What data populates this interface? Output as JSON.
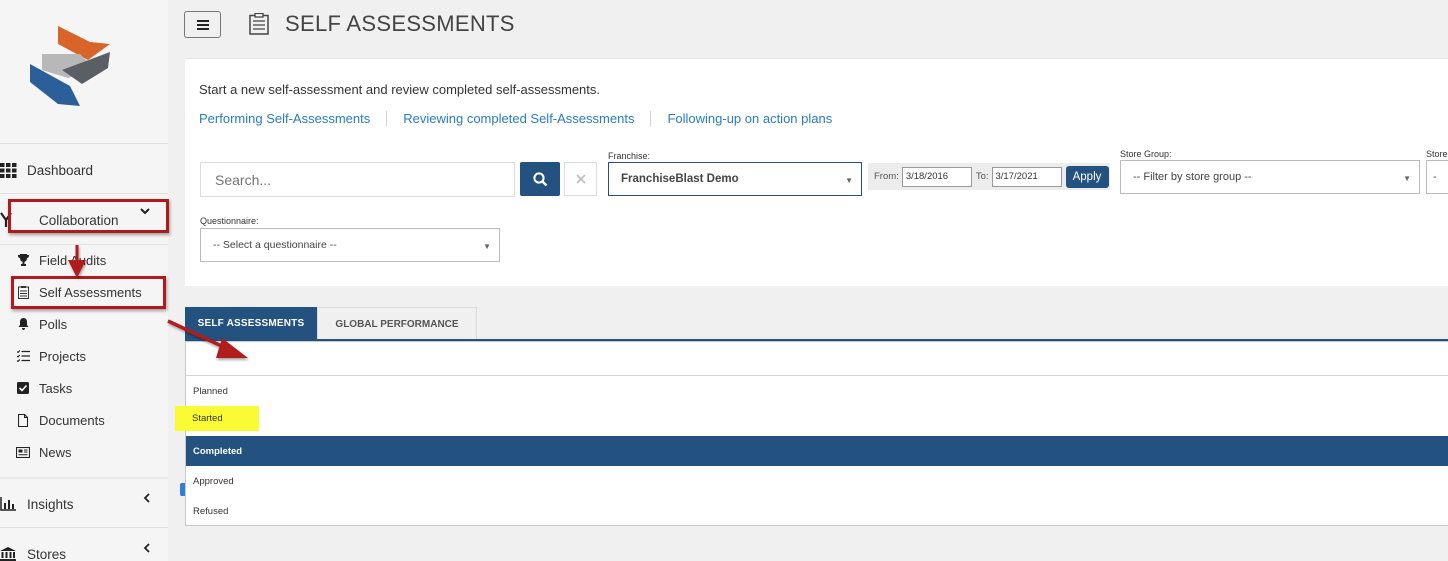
{
  "header": {
    "title": "SELF ASSESSMENTS"
  },
  "sidebar": {
    "main_items": [
      {
        "label": "Dashboard"
      },
      {
        "label": "Collaboration"
      },
      {
        "label": "Insights"
      },
      {
        "label": "Stores"
      }
    ],
    "sub_items": [
      {
        "label": "Field Audits"
      },
      {
        "label": "Self Assessments"
      },
      {
        "label": "Polls"
      },
      {
        "label": "Projects"
      },
      {
        "label": "Tasks"
      },
      {
        "label": "Documents"
      },
      {
        "label": "News"
      }
    ]
  },
  "intro": {
    "text": "Start a new self-assessment and review completed self-assessments.",
    "links": [
      "Performing Self-Assessments",
      "Reviewing completed Self-Assessments",
      "Following-up on action plans"
    ]
  },
  "filters": {
    "search_placeholder": "Search...",
    "franchise_label": "Franchise:",
    "franchise_value": "FranchiseBlast Demo",
    "from_label": "From:",
    "from_value": "3/18/2016",
    "to_label": "To:",
    "to_value": "3/17/2021",
    "apply_label": "Apply",
    "store_group_label": "Store Group:",
    "store_group_value": "-- Filter by store group --",
    "store_label": "Store",
    "questionnaire_label": "Questionnaire:",
    "questionnaire_value": "-- Select a questionnaire --"
  },
  "tabs": [
    "SELF ASSESSMENTS",
    "GLOBAL PERFORMANCE"
  ],
  "status_options": [
    "Planned",
    "Started",
    "Completed",
    "Approved",
    "Refused"
  ],
  "colors": {
    "primary": "#245280",
    "link": "#2a7bbf",
    "annotation_red": "#b11a1a",
    "highlight": "#fbfb35"
  }
}
